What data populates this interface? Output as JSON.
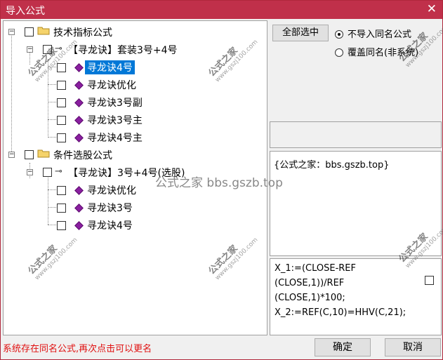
{
  "window": {
    "title": "导入公式",
    "close": "✕"
  },
  "tree": {
    "groups": [
      {
        "label": "技术指标公式",
        "sub": "【寻龙诀】套装3号+4号",
        "items": [
          "寻龙诀4号",
          "寻龙诀优化",
          "寻龙诀3号副",
          "寻龙诀3号主",
          "寻龙诀4号主"
        ]
      },
      {
        "label": "条件选股公式",
        "sub": "【寻龙诀】3号+4号(选股)",
        "items": [
          "寻龙诀优化",
          "寻龙诀3号",
          "寻龙诀4号"
        ]
      }
    ]
  },
  "watermark": {
    "title": "公式之家",
    "url": "www.gszj100.com"
  },
  "overlay_watermark": "公式之家 bbs.gszb.top",
  "options": {
    "select_all": "全部选中",
    "radio_skip": "不导入同名公式",
    "radio_overwrite": "覆盖同名(非系统)"
  },
  "info": "{公式之家：bbs.gszb.top}",
  "code": [
    "X_1:=(CLOSE-REF",
    "(CLOSE,1))/REF",
    "(CLOSE,1)*100;",
    "X_2:=REF(C,10)=HHV(C,21);"
  ],
  "status": "系统存在同名公式,再次点击可以更名",
  "buttons": {
    "ok": "确定",
    "cancel": "取消"
  }
}
